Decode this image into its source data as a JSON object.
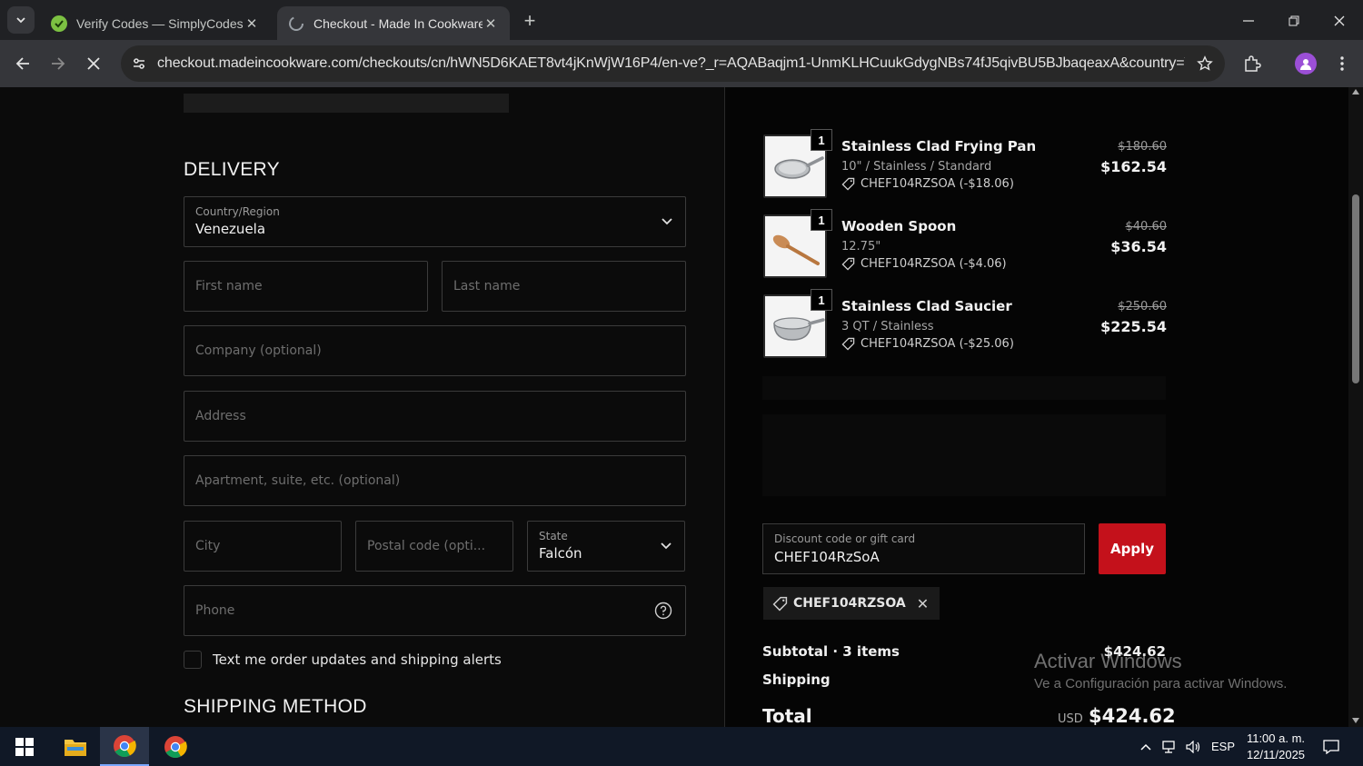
{
  "browser": {
    "tabs": [
      {
        "title": "Verify Codes — SimplyCodes",
        "active": false
      },
      {
        "title": "Checkout - Made In Cookware",
        "active": true
      }
    ],
    "url": "checkout.madeincookware.com/checkouts/cn/hWN5D6KAET8vt4jKnWjW16P4/en-ve?_r=AQABaqjm1-UnmKLHCuukGdygNBs74fJ5qivBU5BJbaqeaxA&country=VE&c..."
  },
  "delivery": {
    "title": "DELIVERY",
    "country": {
      "label": "Country/Region",
      "value": "Venezuela"
    },
    "first_name": {
      "placeholder": "First name"
    },
    "last_name": {
      "placeholder": "Last name"
    },
    "company": {
      "placeholder": "Company (optional)"
    },
    "address": {
      "placeholder": "Address"
    },
    "apartment": {
      "placeholder": "Apartment, suite, etc. (optional)"
    },
    "city": {
      "placeholder": "City"
    },
    "postal": {
      "placeholder": "Postal code (opti..."
    },
    "state": {
      "label": "State",
      "value": "Falcón"
    },
    "phone": {
      "placeholder": "Phone"
    },
    "sms_opt_in": {
      "label": "Text me order updates and shipping alerts",
      "checked": false
    }
  },
  "shipping_method": {
    "title": "SHIPPING METHOD"
  },
  "order": {
    "items": [
      {
        "qty": "1",
        "name": "Stainless Clad Frying Pan",
        "variant": "10\" / Stainless / Standard",
        "discount": "CHEF104RZSOA (-$18.06)",
        "old_price": "$180.60",
        "price": "$162.54",
        "image": "frying-pan"
      },
      {
        "qty": "1",
        "name": "Wooden Spoon",
        "variant": "12.75\"",
        "discount": "CHEF104RZSOA (-$4.06)",
        "old_price": "$40.60",
        "price": "$36.54",
        "image": "wooden-spoon"
      },
      {
        "qty": "1",
        "name": "Stainless Clad Saucier",
        "variant": "3 QT / Stainless",
        "discount": "CHEF104RZSOA (-$25.06)",
        "old_price": "$250.60",
        "price": "$225.54",
        "image": "saucier"
      }
    ],
    "discount_field": {
      "label": "Discount code or gift card",
      "value": "CHEF104RzSoA"
    },
    "apply_label": "Apply",
    "applied_code": "CHEF104RZSOA",
    "subtotal": {
      "label": "Subtotal · 3 items",
      "value": "$424.62"
    },
    "shipping": {
      "label": "Shipping"
    },
    "total": {
      "label": "Total",
      "currency": "USD",
      "value": "$424.62"
    }
  },
  "watermark": {
    "line1": "Activar Windows",
    "line2": "Ve a Configuración para activar Windows."
  },
  "taskbar": {
    "language": "ESP",
    "time": "11:00 a. m.",
    "date": "12/11/2025"
  },
  "colors": {
    "accent": "#c4111b",
    "page_bg": "#0b0b0b",
    "chrome_bg": "#202124"
  }
}
